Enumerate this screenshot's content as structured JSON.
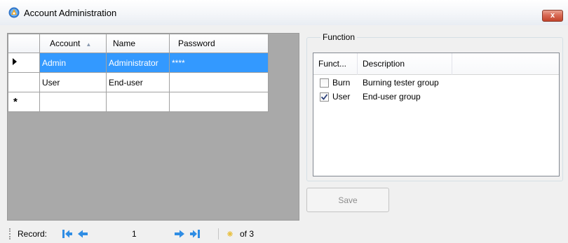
{
  "window": {
    "title": "Account Administration",
    "close_label": "x"
  },
  "grid": {
    "columns": [
      "Account",
      "Name",
      "Password"
    ],
    "rows": [
      {
        "account": "Admin",
        "name": "Administrator",
        "password": "****"
      },
      {
        "account": "User",
        "name": "End-user",
        "password": ""
      }
    ],
    "new_row_marker": "*"
  },
  "function_group": {
    "legend": "Function",
    "columns": [
      "Funct...",
      "Description"
    ],
    "items": [
      {
        "function": "Burn",
        "description": "Burning tester group",
        "checked": false
      },
      {
        "function": "User",
        "description": "End-user group",
        "checked": true
      }
    ]
  },
  "save_label": "Save",
  "navigator": {
    "record_label": "Record:",
    "position": "1",
    "count_label": "of 3"
  }
}
